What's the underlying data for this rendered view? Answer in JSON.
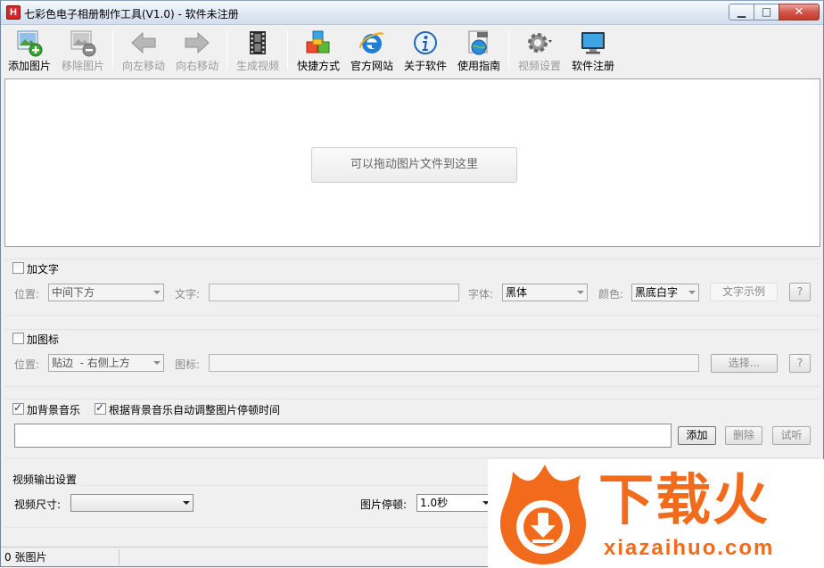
{
  "window": {
    "title": "七彩色电子相册制作工具(V1.0) - 软件未注册",
    "app_icon_letter": "H"
  },
  "toolbar": {
    "items": [
      {
        "label": "添加图片",
        "icon": "add-image-icon",
        "enabled": true
      },
      {
        "label": "移除图片",
        "icon": "remove-image-icon",
        "enabled": false
      },
      {
        "label": "向左移动",
        "icon": "arrow-left-icon",
        "enabled": false
      },
      {
        "label": "向右移动",
        "icon": "arrow-right-icon",
        "enabled": false
      },
      {
        "label": "生成视频",
        "icon": "film-icon",
        "enabled": false
      },
      {
        "label": "快捷方式",
        "icon": "cubes-icon",
        "enabled": true
      },
      {
        "label": "官方网站",
        "icon": "ie-icon",
        "enabled": true
      },
      {
        "label": "关于软件",
        "icon": "info-icon",
        "enabled": true
      },
      {
        "label": "使用指南",
        "icon": "help-globe-icon",
        "enabled": true
      },
      {
        "label": "视频设置",
        "icon": "gear-icon",
        "enabled": false
      },
      {
        "label": "软件注册",
        "icon": "monitor-icon",
        "enabled": true
      }
    ]
  },
  "droparea": {
    "hint": "可以拖动图片文件到这里"
  },
  "text_group": {
    "checkbox_label": "加文字",
    "checked": false,
    "position_label": "位置:",
    "position_value": "中间下方",
    "text_label": "文字:",
    "text_value": "",
    "font_label": "字体:",
    "font_value": "黑体",
    "color_label": "颜色:",
    "color_value": "黑底白字",
    "sample_button": "文字示例",
    "help_button": "?"
  },
  "icon_group": {
    "checkbox_label": "加图标",
    "checked": false,
    "position_label": "位置:",
    "position_value": "贴边  - 右侧上方",
    "icon_label": "图标:",
    "icon_value": "",
    "select_button": "选择...",
    "help_button": "?"
  },
  "music_group": {
    "bgm_label": "加背景音乐",
    "bgm_checked": true,
    "auto_label": "根据背景音乐自动调整图片停顿时间",
    "auto_checked": true,
    "file_value": "",
    "add_button": "添加",
    "delete_button": "删除",
    "preview_button": "试听"
  },
  "output_group": {
    "title": "视频输出设置",
    "size_label": "视频尺寸:",
    "size_value": "",
    "pause_label": "图片停顿:",
    "pause_value": "1.0秒"
  },
  "statusbar": {
    "count_text": "0 张图片"
  },
  "watermark": {
    "brand": "下载火",
    "url": "xiazaihuo.com",
    "color": "#f26a1b"
  }
}
